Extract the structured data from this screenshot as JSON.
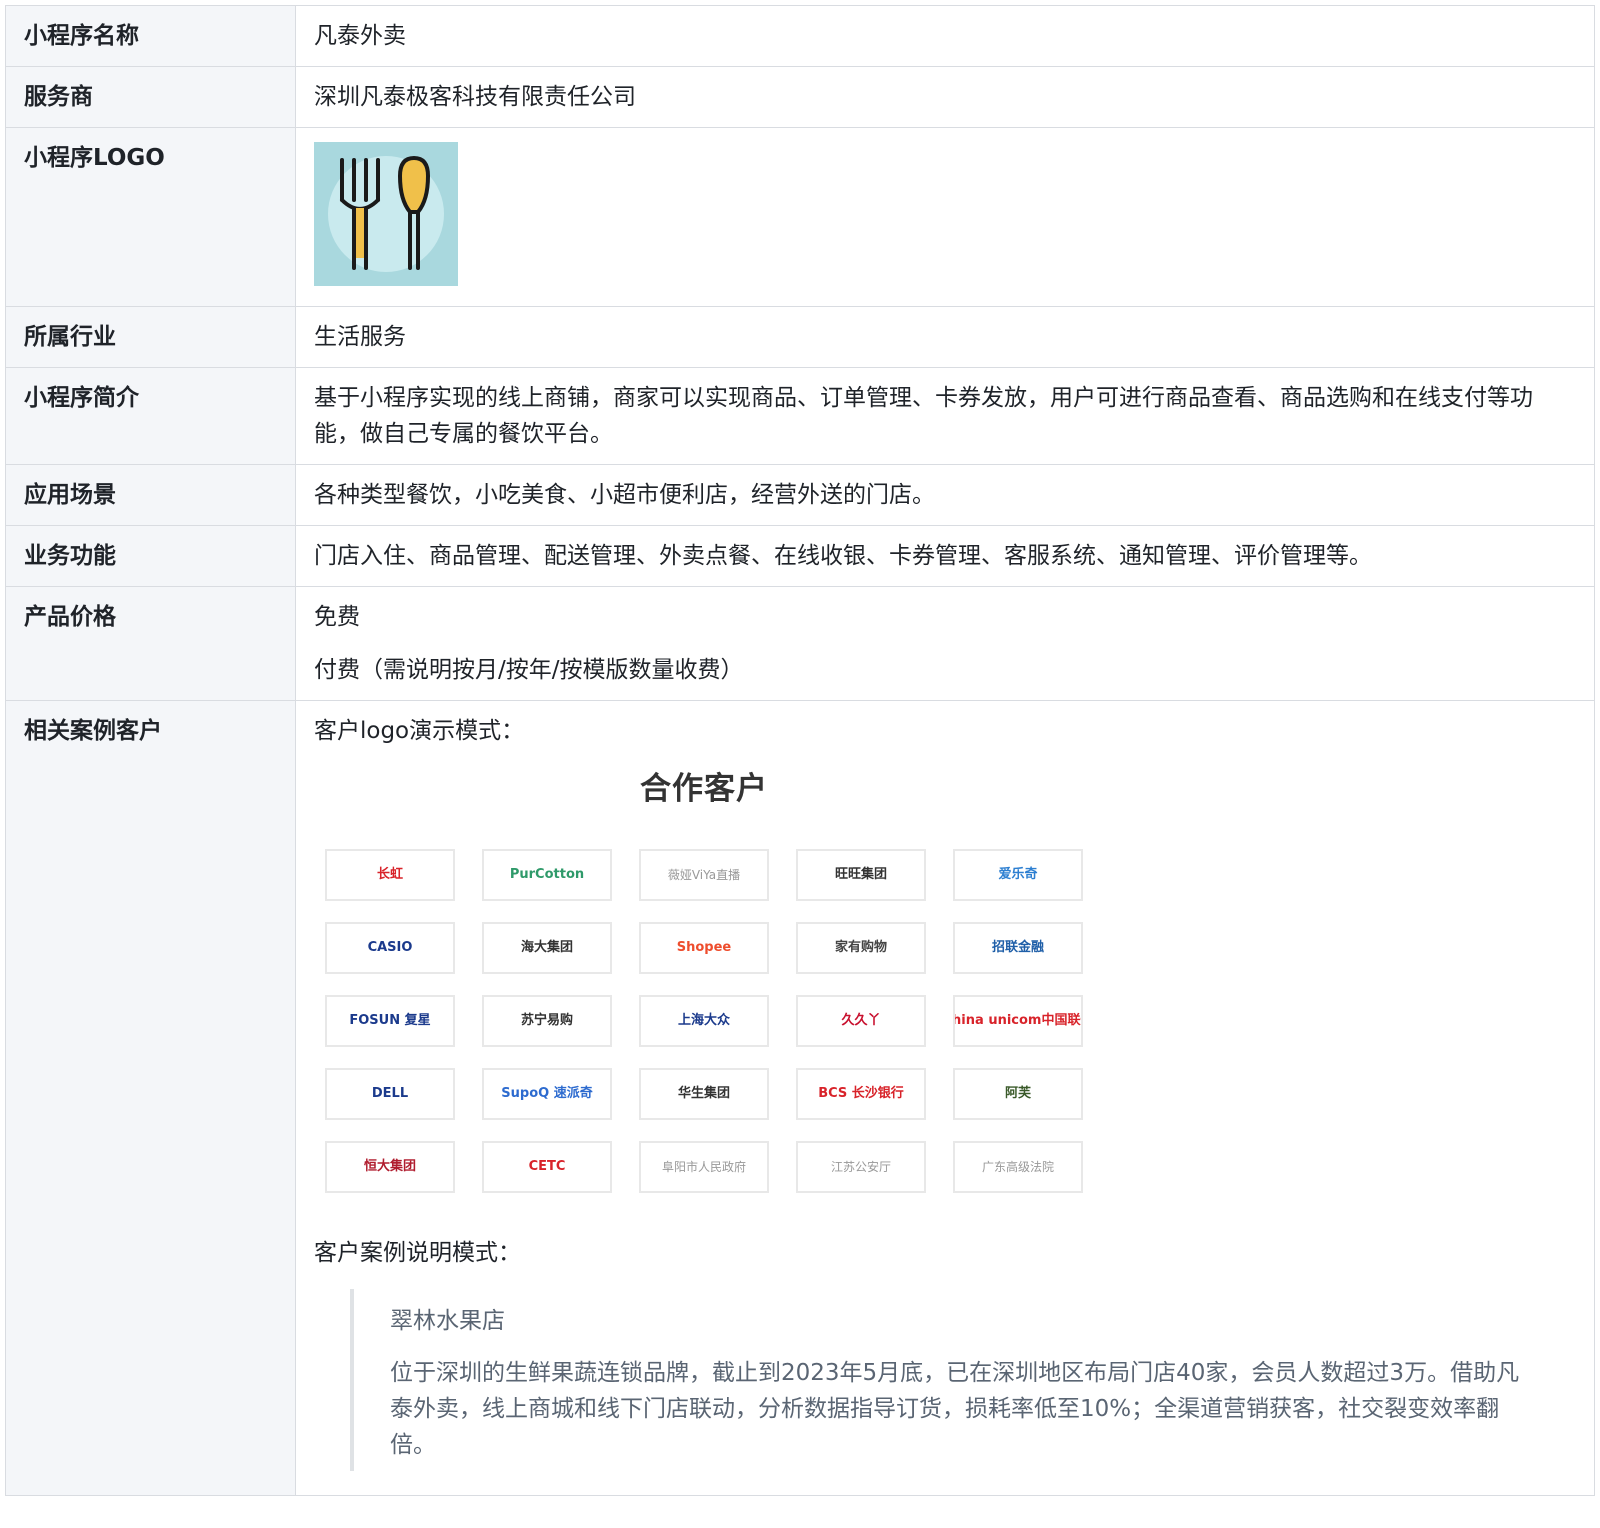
{
  "rows": {
    "name": {
      "label": "小程序名称",
      "value": "凡泰外卖"
    },
    "provider": {
      "label": "服务商",
      "value": "深圳凡泰极客科技有限责任公司"
    },
    "logo": {
      "label": "小程序LOGO",
      "icon": "fork-and-spoon-icon",
      "bg_color": "#a9d8de"
    },
    "industry": {
      "label": "所属行业",
      "value": "生活服务"
    },
    "intro": {
      "label": "小程序简介",
      "value": "基于小程序实现的线上商铺，商家可以实现商品、订单管理、卡券发放，用户可进行商品查看、商品选购和在线支付等功能，做自己专属的餐饮平台。"
    },
    "scenario": {
      "label": "应用场景",
      "value": "各种类型餐饮，小吃美食、小超市便利店，经营外送的门店。"
    },
    "features": {
      "label": "业务功能",
      "value": "门店入住、商品管理、配送管理、外卖点餐、在线收银、卡券管理、客服系统、通知管理、评价管理等。"
    },
    "price": {
      "label": "产品价格",
      "free": "免费",
      "paid": "付费（需说明按月/按年/按模版数量收费）"
    },
    "cases": {
      "label": "相关案例客户",
      "logo_mode_label": "客户logo演示模式：",
      "wall_title": "合作客户",
      "clients": [
        {
          "text": "长虹",
          "color": "#d8232a"
        },
        {
          "text": "PurCotton",
          "color": "#2f9a6a"
        },
        {
          "text": "薇娅ViYa直播",
          "color": "#999999"
        },
        {
          "text": "旺旺集团",
          "color": "#333333"
        },
        {
          "text": "爱乐奇",
          "color": "#2d7fd1"
        },
        {
          "text": "CASIO",
          "color": "#1b3a8c"
        },
        {
          "text": "海大集团",
          "color": "#333333"
        },
        {
          "text": "Shopee",
          "color": "#ee4d2d"
        },
        {
          "text": "家有购物",
          "color": "#444444"
        },
        {
          "text": "招联金融",
          "color": "#1f5fa8"
        },
        {
          "text": "FOSUN 复星",
          "color": "#1b3a8c"
        },
        {
          "text": "苏宁易购",
          "color": "#333333"
        },
        {
          "text": "上海大众",
          "color": "#1b3a8c"
        },
        {
          "text": "久久丫",
          "color": "#c8102e"
        },
        {
          "text": "China unicom中国联通",
          "color": "#d8232a"
        },
        {
          "text": "DELL",
          "color": "#1b3a8c"
        },
        {
          "text": "SupoQ 速派奇",
          "color": "#2d6bcf"
        },
        {
          "text": "华生集团",
          "color": "#333333"
        },
        {
          "text": "BCS 长沙银行",
          "color": "#d8232a"
        },
        {
          "text": "阿芙",
          "color": "#3a5a2a"
        },
        {
          "text": "恒大集团",
          "color": "#b01c2e"
        },
        {
          "text": "CETC",
          "color": "#d8232a"
        },
        {
          "text": "阜阳市人民政府",
          "color": "#999999"
        },
        {
          "text": "江苏公安厅",
          "color": "#999999"
        },
        {
          "text": "广东高级法院",
          "color": "#999999"
        }
      ],
      "case_mode_label": "客户案例说明模式：",
      "case_title": "翠林水果店",
      "case_text": "位于深圳的生鲜果蔬连锁品牌，截止到2023年5月底，已在深圳地区布局门店40家，会员人数超过3万。借助凡泰外卖，线上商城和线下门店联动，分析数据指导订货，损耗率低至10%；全渠道营销获客，社交裂变效率翻倍。"
    }
  }
}
